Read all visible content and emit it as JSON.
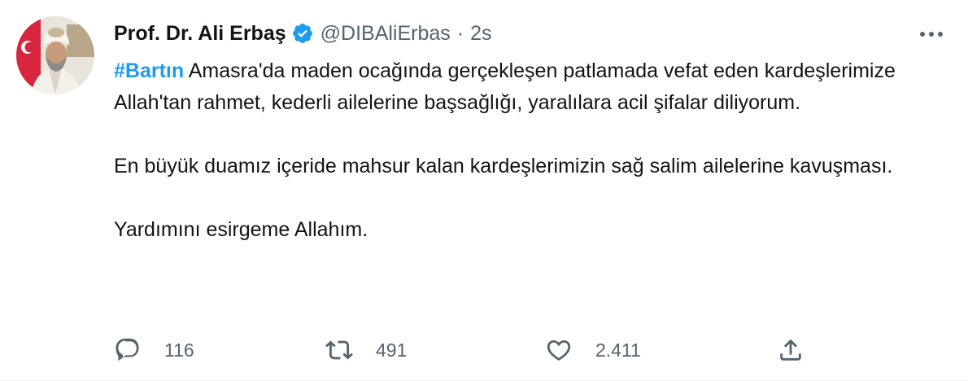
{
  "author": {
    "display_name": "Prof. Dr. Ali Erbaş",
    "handle": "@DIBAliErbas",
    "separator": "·",
    "time": "2s",
    "verified": true
  },
  "tweet": {
    "hashtag": "#Bartın",
    "paragraph1_rest": " Amasra'da maden ocağında gerçekleşen patlamada vefat eden kardeşlerimize Allah'tan rahmet, kederli ailelerine başsağlığı, yaralılara acil şifalar diliyorum.",
    "paragraph2": "En büyük duamız içeride mahsur kalan kardeşlerimizin sağ salim ailelerine kavuşması.",
    "paragraph3": "Yardımını esirgeme Allahım."
  },
  "actions": {
    "reply_count": "116",
    "retweet_count": "491",
    "like_count": "2.411"
  },
  "colors": {
    "accent": "#1d9bf0",
    "text": "#0f1419",
    "secondary": "#536471"
  },
  "icons": [
    "verified-badge-icon",
    "more-icon",
    "reply-icon",
    "retweet-icon",
    "like-icon",
    "share-icon"
  ]
}
